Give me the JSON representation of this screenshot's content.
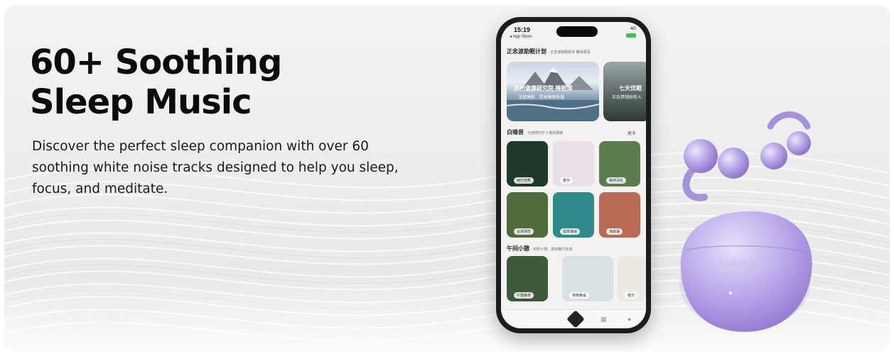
{
  "headline": {
    "line1": "60+ Soothing",
    "line2": "Sleep Music"
  },
  "description": "Discover the perfect sleep companion with over 60 soothing white noise tracks designed to help you sleep, focus, and meditate.",
  "phone": {
    "status_time": "15:19",
    "back_label": "◂ App Store",
    "signal_text": "4G",
    "section1_title": "正念波助眠计划",
    "section1_sub": "- 正念波助眠技术 睡得更深",
    "hero_cards": [
      {
        "title": "苏州健康研究院-睡眠馆",
        "subtitle": "深度睡眠 · 提高睡眠质量"
      },
      {
        "title": "七天优眠",
        "subtitle": "正念冥想助你入"
      }
    ],
    "section2_title": "白噪音",
    "section2_sub": "- 大自然归于人类的馈赠",
    "section2_more": "更多",
    "tiles": [
      {
        "label": "雨打芭蕉",
        "color": "#1f3a2a"
      },
      {
        "label": "春日",
        "color": "#e9dfe6"
      },
      {
        "label": "森林深处",
        "color": "#5a7c4e"
      },
      {
        "label": "丛林探险",
        "color": "#4f6b3a"
      },
      {
        "label": "拍岸海浪",
        "color": "#2f8a8c"
      },
      {
        "label": "海浪涌",
        "color": "#b96a55"
      }
    ],
    "section3_title": "午间小憩",
    "section3_sub": "- 科学小憩，高效精力充沛",
    "nap_tiles": [
      {
        "label": "午憩森林",
        "color": "#3d5a3a"
      },
      {
        "label": "夜晚静谧",
        "color": "#d8e2e4"
      },
      {
        "label": "春日",
        "color": "#ece8e2"
      }
    ]
  },
  "product": {
    "case_logo": "Soleag",
    "accent_color": "#9f88d8"
  }
}
